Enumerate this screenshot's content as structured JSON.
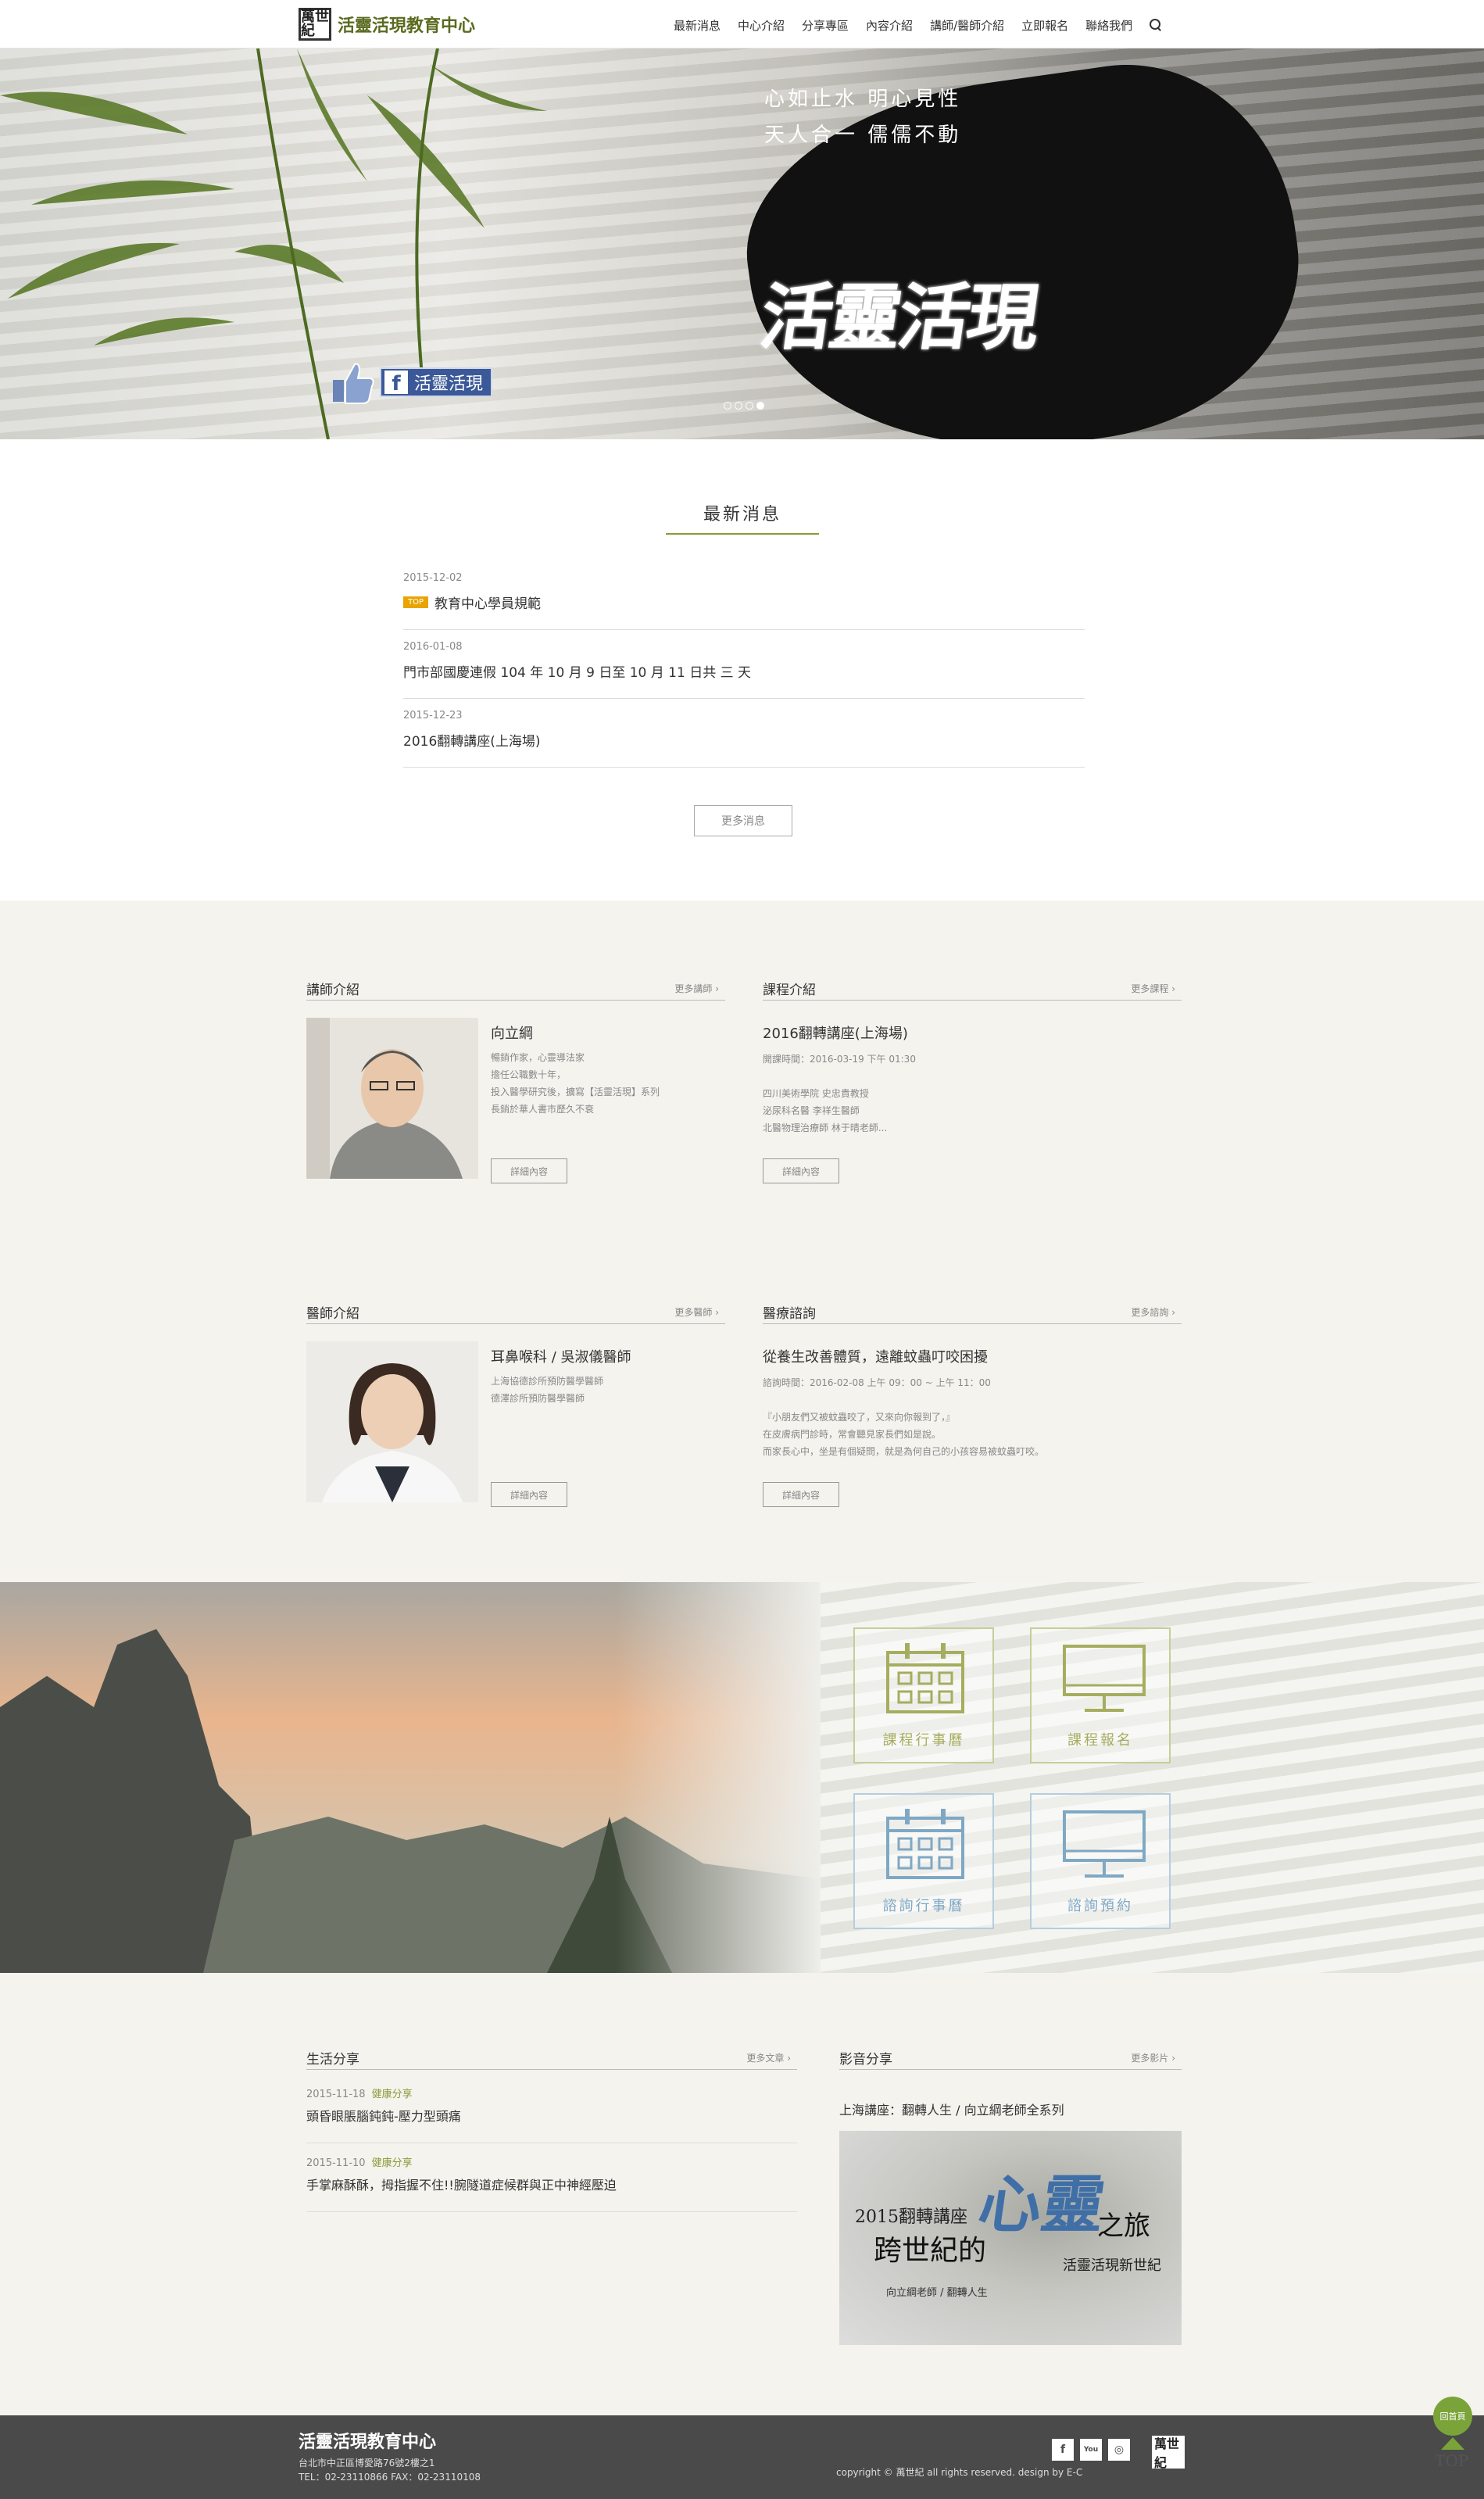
{
  "header": {
    "site_name": "活靈活現教育中心",
    "logo_seal": "萬世紀",
    "nav": [
      "最新消息",
      "中心介紹",
      "分享專區",
      "內容介紹",
      "講師/醫師介紹",
      "立即報名",
      "聯絡我們"
    ]
  },
  "hero": {
    "tagline_1": "心如止水  明心見性",
    "tagline_2": "天人合一  儒儒不動",
    "calligraphy": "活靈活現",
    "fb_label": "活靈活現"
  },
  "news": {
    "title": "最新消息",
    "items": [
      {
        "date": "2015-12-02",
        "badge": "TOP",
        "title": "教育中心學員規範"
      },
      {
        "date": "2016-01-08",
        "badge": "",
        "title": "門市部國慶連假 104 年 10 月 9 日至 10 月 11 日共 三 天"
      },
      {
        "date": "2015-12-23",
        "badge": "",
        "title": "2016翻轉講座(上海場)"
      }
    ],
    "more": "更多消息"
  },
  "lecturer": {
    "title": "講師介紹",
    "more": "更多講師 ›",
    "name": "向立綱",
    "desc": [
      "暢銷作家，心靈導法家",
      "擔任公職數十年，",
      "投入醫學研究後，擴寫【活靈活現】系列",
      "長銷於華人書市歷久不衰"
    ],
    "btn": "詳細內容"
  },
  "course": {
    "title": "課程介紹",
    "more": "更多課程 ›",
    "name": "2016翻轉講座(上海場)",
    "time": "開課時間：2016-03-19 下午 01:30",
    "desc": [
      "四川美術學院 史忠貴教授",
      "泌尿科名醫 李祥生醫師",
      "北醫物理治療師 林于晴老師..."
    ],
    "btn": "詳細內容"
  },
  "doctor": {
    "title": "醫師介紹",
    "more": "更多醫師 ›",
    "name": "耳鼻喉科 / 吳淑儀醫師",
    "desc": [
      "上海協德診所預防醫學醫師",
      "德澤診所預防醫學醫師"
    ],
    "btn": "詳細內容"
  },
  "consult": {
    "title": "醫療諮詢",
    "more": "更多諮詢 ›",
    "name": "從養生改善體質，遠離蚊蟲叮咬困擾",
    "time": "諮詢時間：2016-02-08 上午 09：00 ~ 上午 11：00",
    "desc": [
      "『小朋友們又被蚊蟲咬了，又來向你報到了，』",
      "在皮膚病門診時，常會聽見家長們如是說。",
      "而家長心中，坐是有個疑問，就是為何自己的小孩容易被蚊蟲叮咬。"
    ],
    "btn": "詳細內容"
  },
  "tiles": [
    {
      "label": "課程行事曆",
      "color": "#a6ad5f"
    },
    {
      "label": "課程報名",
      "color": "#a6ad5f"
    },
    {
      "label": "諮詢行事曆",
      "color": "#7fa8c4"
    },
    {
      "label": "諮詢預約",
      "color": "#7fa8c4"
    }
  ],
  "life": {
    "title": "生活分享",
    "more": "更多文章 ›",
    "items": [
      {
        "date": "2015-11-18",
        "cat": "健康分享",
        "title": "頭昏眼脹腦鈍鈍-壓力型頭痛"
      },
      {
        "date": "2015-11-10",
        "cat": "健康分享",
        "title": "手掌麻酥酥，拇指握不住!!腕隧道症候群與正中神經壓迫"
      }
    ]
  },
  "video": {
    "title": "影音分享",
    "more": "更多影片 ›",
    "caption": "上海講座：翻轉人生 / 向立綱老師全系列",
    "poster_l1": "2015翻轉講座",
    "poster_l2": "跨世紀的",
    "poster_big": "心靈",
    "poster_l3": "之旅",
    "poster_l4": "活靈活現新世紀",
    "poster_l5": "向立綱老師 / 翻轉人生"
  },
  "footer": {
    "name": "活靈活現教育中心",
    "address": "台北市中正區博愛路76號2樓之1",
    "tel": "TEL：02-23110866  FAX：02-23110108",
    "copyright": "copyright © 萬世紀 all rights reserved. design by E-C",
    "social": [
      "f",
      "You",
      "◎"
    ],
    "seal": "萬世紀"
  },
  "gotop": {
    "circle": "回首頁",
    "text": "TOP"
  }
}
